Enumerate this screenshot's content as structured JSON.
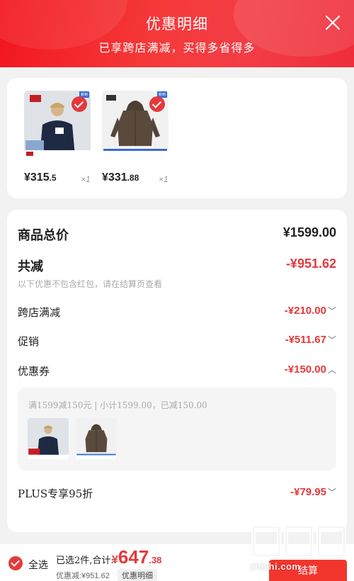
{
  "header": {
    "title": "优惠明细",
    "subtitle": "已享跨店满减，买得多省得多"
  },
  "products": [
    {
      "price_int": "¥315",
      "price_dec": ".5",
      "qty": "×1",
      "badge": "新到",
      "thumb": "jacket-model",
      "brand_mark": "Levi's",
      "thumb_count": "426"
    },
    {
      "price_int": "¥331",
      "price_dec": ".88",
      "qty": "×1",
      "badge": "新到",
      "thumb": "hooded-jacket",
      "brand_mark": "Levi's",
      "thumb_count": "432"
    }
  ],
  "summary": {
    "total_label": "商品总价",
    "total_value": "¥1599.00",
    "reduce_label": "共减",
    "reduce_value": "-¥951.62",
    "note": "以下优惠不包含红包，请在结算页查看",
    "lines": [
      {
        "label": "跨店满减",
        "value": "-¥210.00",
        "chevron": "chevron-down-icon"
      },
      {
        "label": "促销",
        "value": "-¥511.67",
        "chevron": "chevron-down-icon"
      },
      {
        "label": "优惠券",
        "value": "-¥150.00",
        "chevron": "chevron-up-icon"
      }
    ],
    "coupon_text": "满1599减150元 | 小计1599.00，已减150.00",
    "plus_label": "PLUS专享95折",
    "plus_value": "-¥79.95"
  },
  "footer": {
    "select_all": "全选",
    "selected_text": "已选2件,合计:",
    "total_yen": "¥",
    "total_int": "647",
    "total_dec": ".38",
    "discount_text": "优惠减:¥951.62",
    "detail_btn": "优惠明细",
    "checkout": "结算"
  },
  "watermark": {
    "site": "zhizhi.com"
  },
  "colors": {
    "accent": "#e4393c",
    "header_start": "#f2161f",
    "header_end": "#ef2d3a"
  }
}
